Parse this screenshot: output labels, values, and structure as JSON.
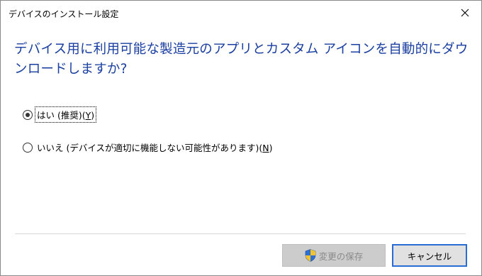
{
  "window": {
    "title": "デバイスのインストール設定"
  },
  "dialog": {
    "heading": "デバイス用に利用可能な製造元のアプリとカスタム アイコンを自動的にダウンロードしますか?"
  },
  "options": [
    {
      "label_text": "はい (推奨)(",
      "accelerator": "Y",
      "label_suffix": ")",
      "checked": true,
      "focused": true
    },
    {
      "label_text": "いいえ (デバイスが適切に機能しない可能性があります)(",
      "accelerator": "N",
      "label_suffix": ")",
      "checked": false,
      "focused": false
    }
  ],
  "buttons": {
    "save_label": "変更の保存",
    "save_enabled": false,
    "cancel_label": "キャンセル"
  },
  "icons": {
    "close": "close-icon",
    "save": "uac-shield-icon"
  },
  "colors": {
    "heading": "#1a3fa0",
    "focus_border": "#2a6cd6",
    "disabled_button": "#cccccc",
    "shield_blue": "#2f6fcf",
    "shield_yellow": "#f2c230"
  }
}
